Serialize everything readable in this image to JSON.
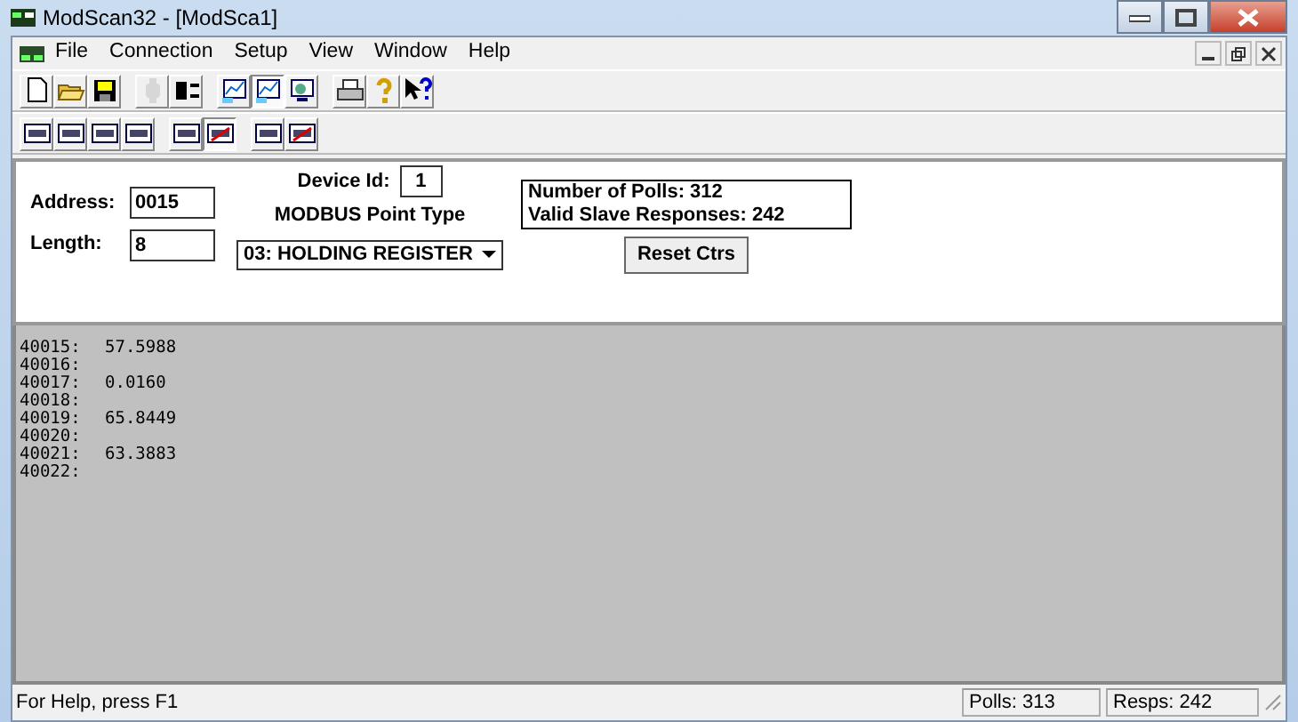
{
  "window": {
    "title": "ModScan32 - [ModSca1]"
  },
  "menu": [
    "File",
    "Connection",
    "Setup",
    "View",
    "Window",
    "Help"
  ],
  "toolbars": [
    [
      [
        {
          "kind": "new",
          "pressed": false,
          "disabled": false
        },
        {
          "kind": "open",
          "pressed": false,
          "disabled": false
        },
        {
          "kind": "save",
          "pressed": false,
          "disabled": false
        }
      ],
      [
        {
          "kind": "connect",
          "pressed": false,
          "disabled": true
        },
        {
          "kind": "disconnect",
          "pressed": false,
          "disabled": false
        }
      ],
      [
        {
          "kind": "chart",
          "pressed": false,
          "disabled": false
        },
        {
          "kind": "chart",
          "pressed": true,
          "disabled": false
        },
        {
          "kind": "screen",
          "pressed": false,
          "disabled": false
        }
      ],
      [
        {
          "kind": "print",
          "pressed": false,
          "disabled": false
        },
        {
          "kind": "help",
          "pressed": false,
          "disabled": false
        },
        {
          "kind": "context-help",
          "pressed": false,
          "disabled": false
        }
      ]
    ],
    [
      [
        {
          "kind": "format",
          "pressed": false,
          "disabled": false
        },
        {
          "kind": "format",
          "pressed": false,
          "disabled": false
        },
        {
          "kind": "format",
          "pressed": false,
          "disabled": false
        },
        {
          "kind": "format",
          "pressed": false,
          "disabled": false
        }
      ],
      [
        {
          "kind": "format",
          "pressed": false,
          "disabled": false
        },
        {
          "kind": "format-red",
          "pressed": true,
          "disabled": false
        }
      ],
      [
        {
          "kind": "format",
          "pressed": false,
          "disabled": false
        },
        {
          "kind": "format-red",
          "pressed": false,
          "disabled": false
        }
      ]
    ]
  ],
  "form": {
    "address_label": "Address:",
    "address": "0015",
    "length_label": "Length:",
    "length": "8",
    "device_id_label": "Device Id:",
    "device_id": "1",
    "point_type_label": "MODBUS Point Type",
    "point_type": "03: HOLDING REGISTER",
    "polls": "Number of Polls: 312",
    "responses": "Valid Slave Responses: 242",
    "reset_button": "Reset Ctrs"
  },
  "data_rows": [
    {
      "address": "40015:",
      "value": "57.5988"
    },
    {
      "address": "40016:"
    },
    {
      "address": "40017:",
      "value": "0.0160"
    },
    {
      "address": "40018:"
    },
    {
      "address": "40019:",
      "value": "65.8449"
    },
    {
      "address": "40020:"
    },
    {
      "address": "40021:",
      "value": "63.3883"
    },
    {
      "address": "40022:"
    }
  ],
  "status_bar": {
    "help": "For Help, press F1",
    "polls": "Polls: 313",
    "resps": "Resps: 242"
  }
}
